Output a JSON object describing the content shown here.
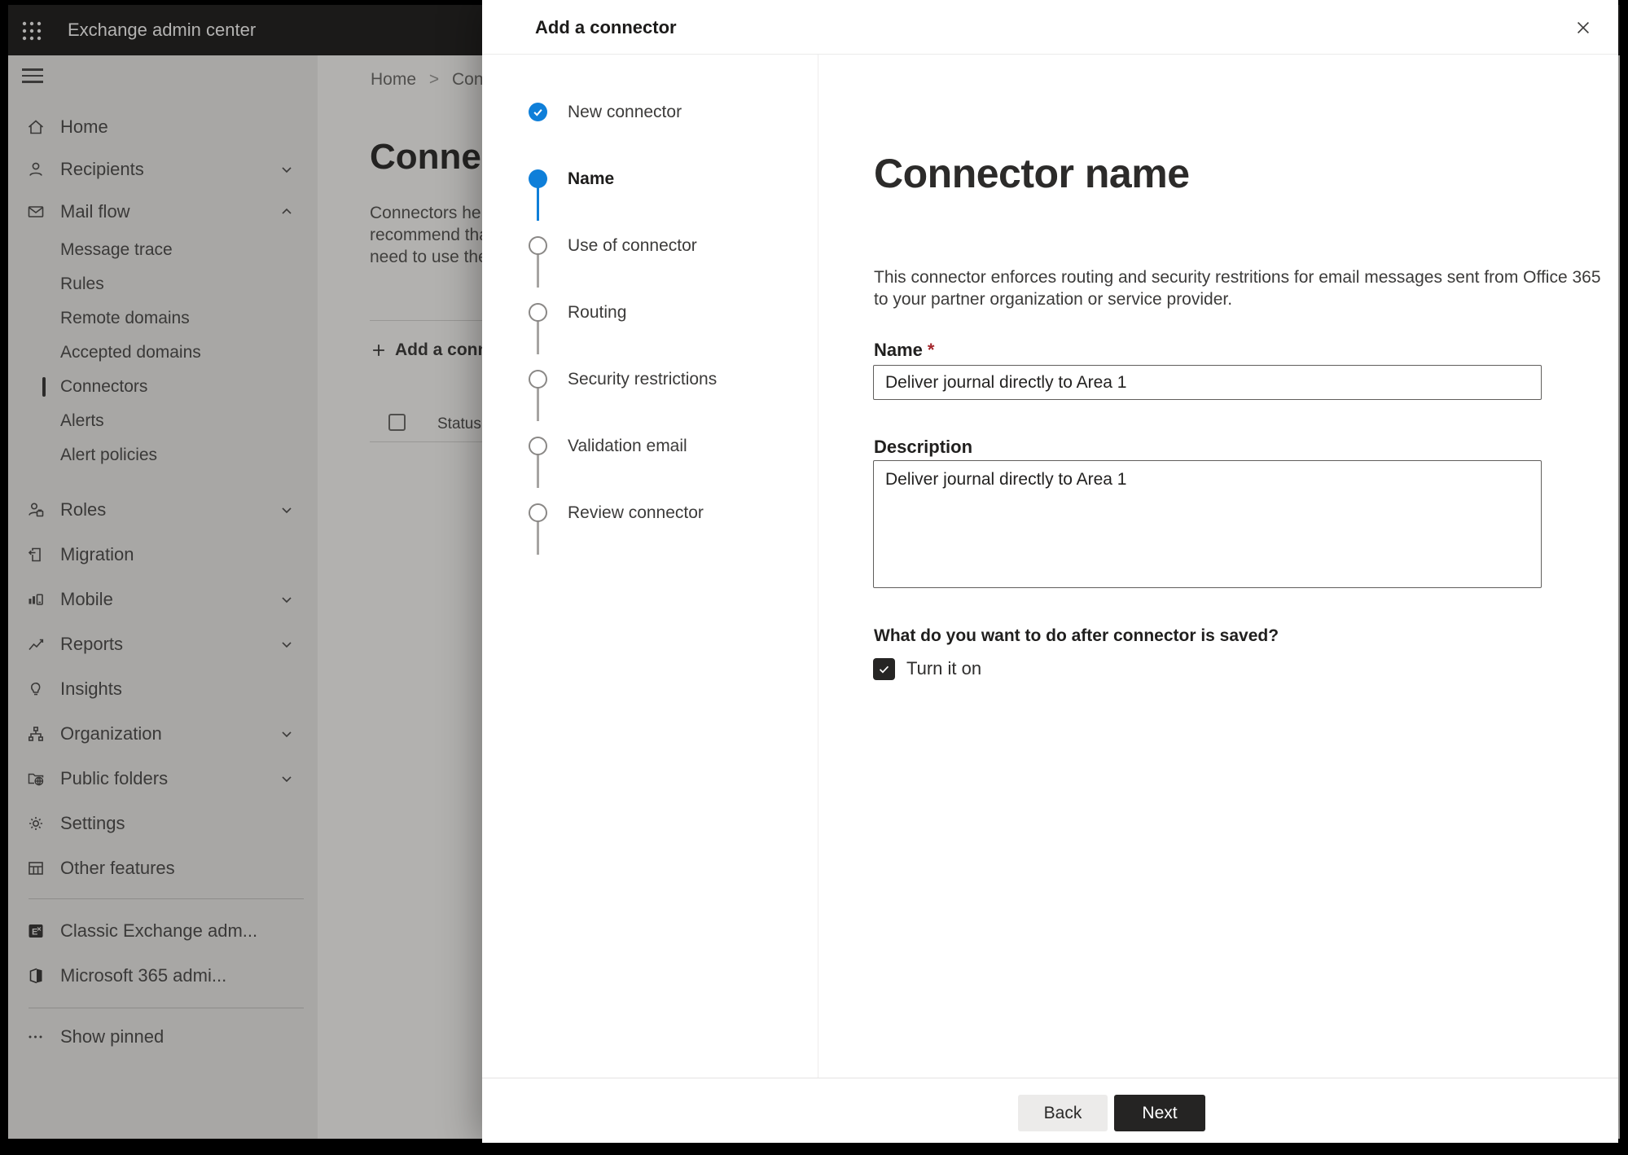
{
  "app": {
    "title": "Exchange admin center"
  },
  "sidebar": {
    "items": [
      {
        "label": "Home",
        "icon": "home"
      },
      {
        "label": "Recipients",
        "icon": "person",
        "chevron": "down"
      },
      {
        "label": "Mail flow",
        "icon": "mail",
        "chevron": "up",
        "expanded": true
      },
      {
        "label": "Message trace",
        "sub": true
      },
      {
        "label": "Rules",
        "sub": true
      },
      {
        "label": "Remote domains",
        "sub": true
      },
      {
        "label": "Accepted domains",
        "sub": true
      },
      {
        "label": "Connectors",
        "sub": true,
        "selected": true
      },
      {
        "label": "Alerts",
        "sub": true
      },
      {
        "label": "Alert policies",
        "sub": true
      },
      {
        "label": "Roles",
        "icon": "person-badge",
        "chevron": "down"
      },
      {
        "label": "Migration",
        "icon": "migration"
      },
      {
        "label": "Mobile",
        "icon": "mobile",
        "chevron": "down"
      },
      {
        "label": "Reports",
        "icon": "reports",
        "chevron": "down"
      },
      {
        "label": "Insights",
        "icon": "insights"
      },
      {
        "label": "Organization",
        "icon": "organization",
        "chevron": "down"
      },
      {
        "label": "Public folders",
        "icon": "public-folders",
        "chevron": "down"
      },
      {
        "label": "Settings",
        "icon": "settings"
      },
      {
        "label": "Other features",
        "icon": "other-features"
      },
      {
        "label": "Classic Exchange adm...",
        "icon": "classic-exchange"
      },
      {
        "label": "Microsoft 365 admi...",
        "icon": "m365"
      },
      {
        "label": "Show pinned",
        "icon": "ellipsis"
      }
    ]
  },
  "page": {
    "breadcrumb": {
      "home": "Home",
      "separator": ">",
      "current": "Conne"
    },
    "heading": "Connect",
    "intro_lines": [
      "Connectors help",
      "recommend that",
      "need to use ther"
    ],
    "add_connector_label": "Add a conn",
    "status_header": "Status"
  },
  "dialog": {
    "title": "Add a connector",
    "steps": [
      {
        "label": "New connector",
        "state": "completed"
      },
      {
        "label": "Name",
        "state": "current"
      },
      {
        "label": "Use of connector",
        "state": "upcoming"
      },
      {
        "label": "Routing",
        "state": "upcoming"
      },
      {
        "label": "Security restrictions",
        "state": "upcoming"
      },
      {
        "label": "Validation email",
        "state": "upcoming"
      },
      {
        "label": "Review connector",
        "state": "upcoming"
      }
    ],
    "content": {
      "title": "Connector name",
      "description_lines": [
        "This connector enforces routing and security restritions for email messages sent from Office 365",
        "to your partner organization or service provider."
      ],
      "name_label": "Name",
      "required_marker": "*",
      "name_value": "Deliver journal directly to Area 1",
      "description_label": "Description",
      "description_value": "Deliver journal directly to Area 1",
      "after_save_question": "What do you want to do after connector is saved?",
      "turn_on": {
        "label": "Turn it on",
        "checked": true
      }
    },
    "footer": {
      "back": "Back",
      "next": "Next"
    }
  },
  "colors": {
    "accent_blue": "#0f7fd9",
    "required_red": "#a4262c",
    "next_button_bg": "#252423",
    "topbar_bg": "#1b1a19",
    "dim_sidebar_bg": "#a8a7a5",
    "dim_content_bg": "#b2b1af"
  }
}
